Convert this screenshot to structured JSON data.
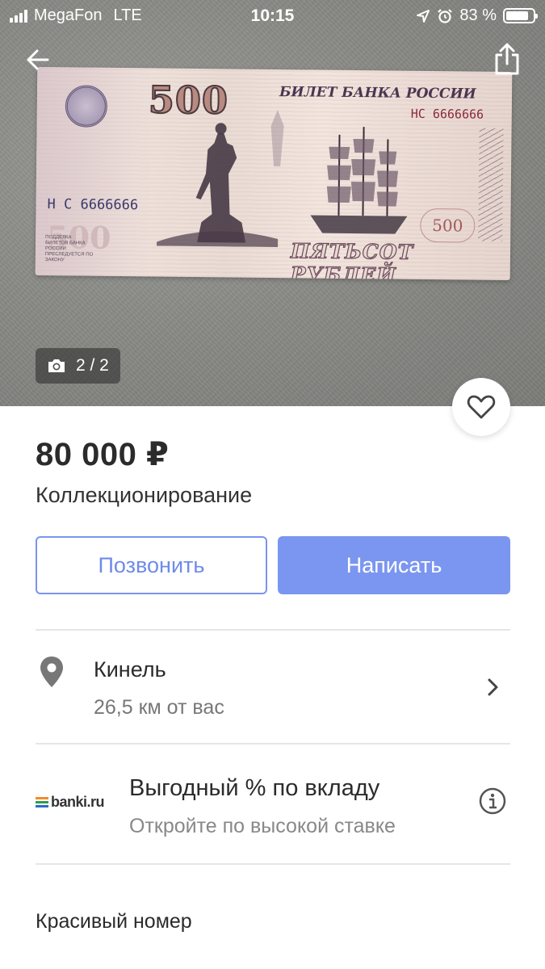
{
  "status_bar": {
    "carrier": "MegaFon",
    "network": "LTE",
    "time": "10:15",
    "battery": "83 %",
    "battery_level": 0.83
  },
  "photo": {
    "counter": "2 / 2",
    "banknote": {
      "denomination": "500",
      "bank_title": "БИЛЕТ БАНКА РОССИИ",
      "serial": "НС 6666666",
      "serial_left": "Н С 6666666",
      "words": "ПЯТЬСОТ РУБЛЕЙ",
      "fine_print": "ПОДДЕЛКА БИЛЕТОВ БАНКА РОССИИ ПРЕСЛЕДУЕТСЯ ПО ЗАКОНУ"
    }
  },
  "listing": {
    "price": "80 000 ₽",
    "category": "Коллекционирование"
  },
  "actions": {
    "call_label": "Позвонить",
    "write_label": "Написать"
  },
  "location": {
    "city": "Кинель",
    "distance": "26,5 км от вас"
  },
  "ad": {
    "logo_text": "banki.ru",
    "title": "Выгодный % по вкладу",
    "subtitle": "Откройте по высокой ставке"
  },
  "description": {
    "text": "Красивый номер"
  },
  "colors": {
    "accent": "#7b96f0",
    "accent_text": "#6f8be8",
    "divider": "#e6e6e6"
  },
  "icons": {
    "back": "arrow-left-icon",
    "share": "share-icon",
    "camera": "camera-icon",
    "favorite": "heart-icon",
    "location": "map-pin-icon",
    "chevron": "chevron-right-icon",
    "info": "info-icon"
  }
}
